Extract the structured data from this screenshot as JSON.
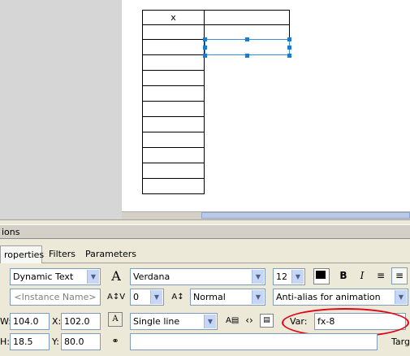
{
  "table": {
    "header": "x"
  },
  "panel": {
    "title": "ions",
    "tabs": [
      {
        "label": "roperties"
      },
      {
        "label": "Filters"
      },
      {
        "label": "Parameters"
      }
    ]
  },
  "properties": {
    "text_type": "Dynamic Text",
    "instance_name_placeholder": "<Instance Name>",
    "font": "Verdana",
    "font_size": "12",
    "color": "#000000",
    "bold_label": "B",
    "italic_label": "I",
    "letter_spacing": "0",
    "char_position": "Normal",
    "anti_alias": "Anti-alias for animation",
    "line_type": "Single line",
    "w_label": "W:",
    "w_value": "104.0",
    "x_label": "X:",
    "x_value": "102.0",
    "h_label": "H:",
    "h_value": "18.5",
    "y_label": "Y:",
    "y_value": "80.0",
    "var_label": "Var:",
    "var_value": "fx-8",
    "target_label": "Targ"
  }
}
